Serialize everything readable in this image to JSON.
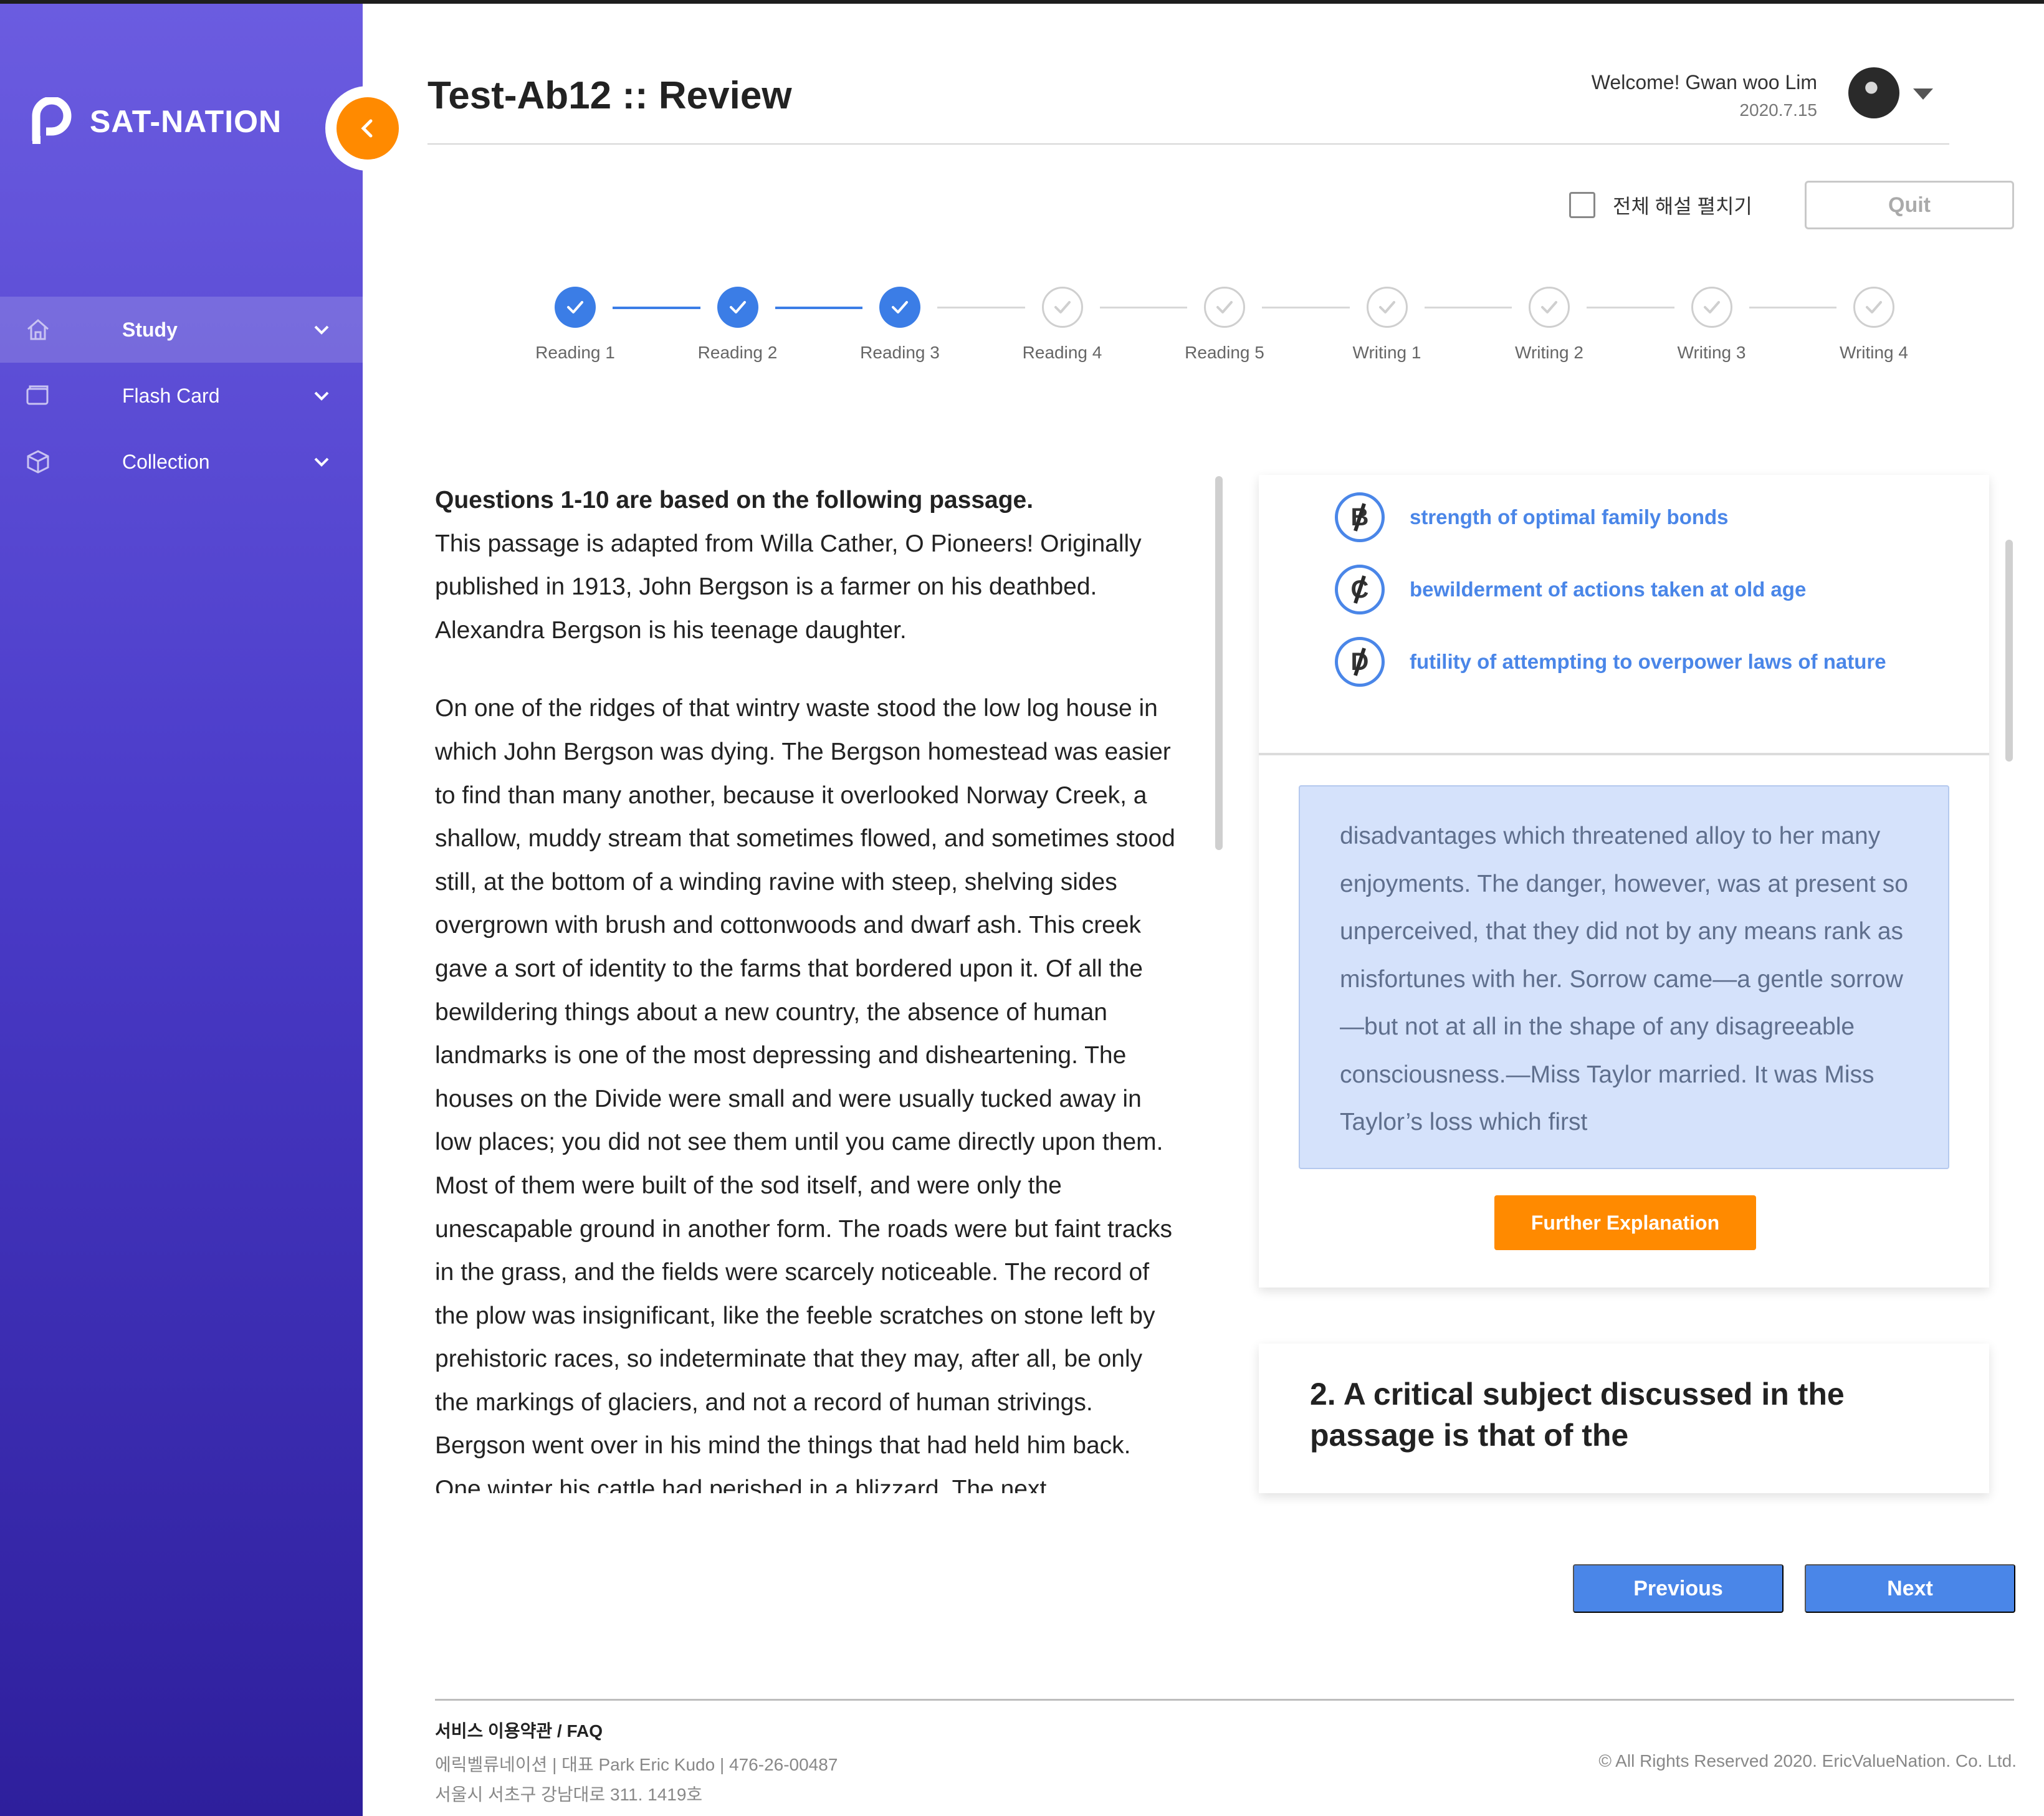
{
  "brand": {
    "name": "SAT-NATION"
  },
  "sidebar": {
    "items": [
      {
        "label": "Study",
        "icon": "home-icon",
        "active": true
      },
      {
        "label": "Flash Card",
        "icon": "card-icon",
        "active": false
      },
      {
        "label": "Collection",
        "icon": "cube-icon",
        "active": false
      }
    ]
  },
  "header": {
    "title": "Test-Ab12 :: Review",
    "welcome": "Welcome! Gwan woo Lim",
    "date": "2020.7.15"
  },
  "controls": {
    "expand_all_label": "전체 해설 펼치기",
    "expand_all_checked": false,
    "quit_label": "Quit"
  },
  "steps": [
    {
      "label": "Reading 1",
      "done": true
    },
    {
      "label": "Reading 2",
      "done": true
    },
    {
      "label": "Reading 3",
      "done": true
    },
    {
      "label": "Reading 4",
      "done": false
    },
    {
      "label": "Reading 5",
      "done": false
    },
    {
      "label": "Writing 1",
      "done": false
    },
    {
      "label": "Writing 2",
      "done": false
    },
    {
      "label": "Writing 3",
      "done": false
    },
    {
      "label": "Writing 4",
      "done": false
    }
  ],
  "passage": {
    "heading": "Questions 1-10 are based on the following passage.",
    "intro": "This passage is adapted from Willa Cather, O Pioneers! Originally published in 1913, John Bergson is a farmer on his deathbed. Alexandra Bergson is his teenage daughter.",
    "body": "On one of the ridges of that wintry waste stood the low log house in which John Bergson was dying. The Bergson homestead was easier to find than many another, because it overlooked Norway Creek, a shallow, muddy stream that sometimes flowed, and sometimes stood still, at the bottom of a winding ravine with steep, shelving sides overgrown with brush and cottonwoods and dwarf ash. This creek gave a sort of identity to the farms that bordered upon it. Of all the bewildering things about a new country, the absence of human landmarks is one of the most depressing and disheartening. The houses on the Divide were small and were usually tucked away in low places; you did not see them until you came directly upon them. Most of them were built of the sod itself, and were only the unescapable ground in another form. The roads were but faint tracks in the grass, and the fields were scarcely noticeable. The record of the plow was insignificant, like the feeble scratches on stone left by prehistoric races, so indeterminate that they may, after all, be only the markings of glaciers, and not a record of human strivings. Bergson went over in his mind the things that had held him back. One winter his cattle had perished in a blizzard. The next"
  },
  "question1": {
    "options": [
      {
        "letter": "B",
        "text": "strength of optimal family bonds"
      },
      {
        "letter": "C",
        "text": "bewilderment of actions taken at old age"
      },
      {
        "letter": "D",
        "text": "futility of attempting to overpower laws of nature"
      }
    ],
    "explanation": "disadvantages which threatened alloy to her many enjoyments. The danger, however, was at present so unperceived, that they did not by any means rank as misfortunes with her. Sorrow came—a gentle sorrow—but not at all in the shape of any disagreeable consciousness.—Miss Taylor married. It was Miss Taylor’s loss which first",
    "further_label": "Further Explanation"
  },
  "question2": {
    "text": "2. A critical subject discussed in the passage is that of the"
  },
  "pager": {
    "previous": "Previous",
    "next": "Next"
  },
  "footer": {
    "links": "서비스 이용약관 / FAQ",
    "company": "에릭벨류네이션 | 대표 Park Eric Kudo | 476-26-00487",
    "address": "서울시 서초구 강남대로 311. 1419호",
    "copyright": "© All Rights Reserved 2020. EricValueNation. Co. Ltd."
  },
  "colors": {
    "accent": "#4a86e8",
    "orange": "#ff8a00",
    "sidebar_top": "#6b5ce0",
    "sidebar_bottom": "#2e1f9c"
  }
}
